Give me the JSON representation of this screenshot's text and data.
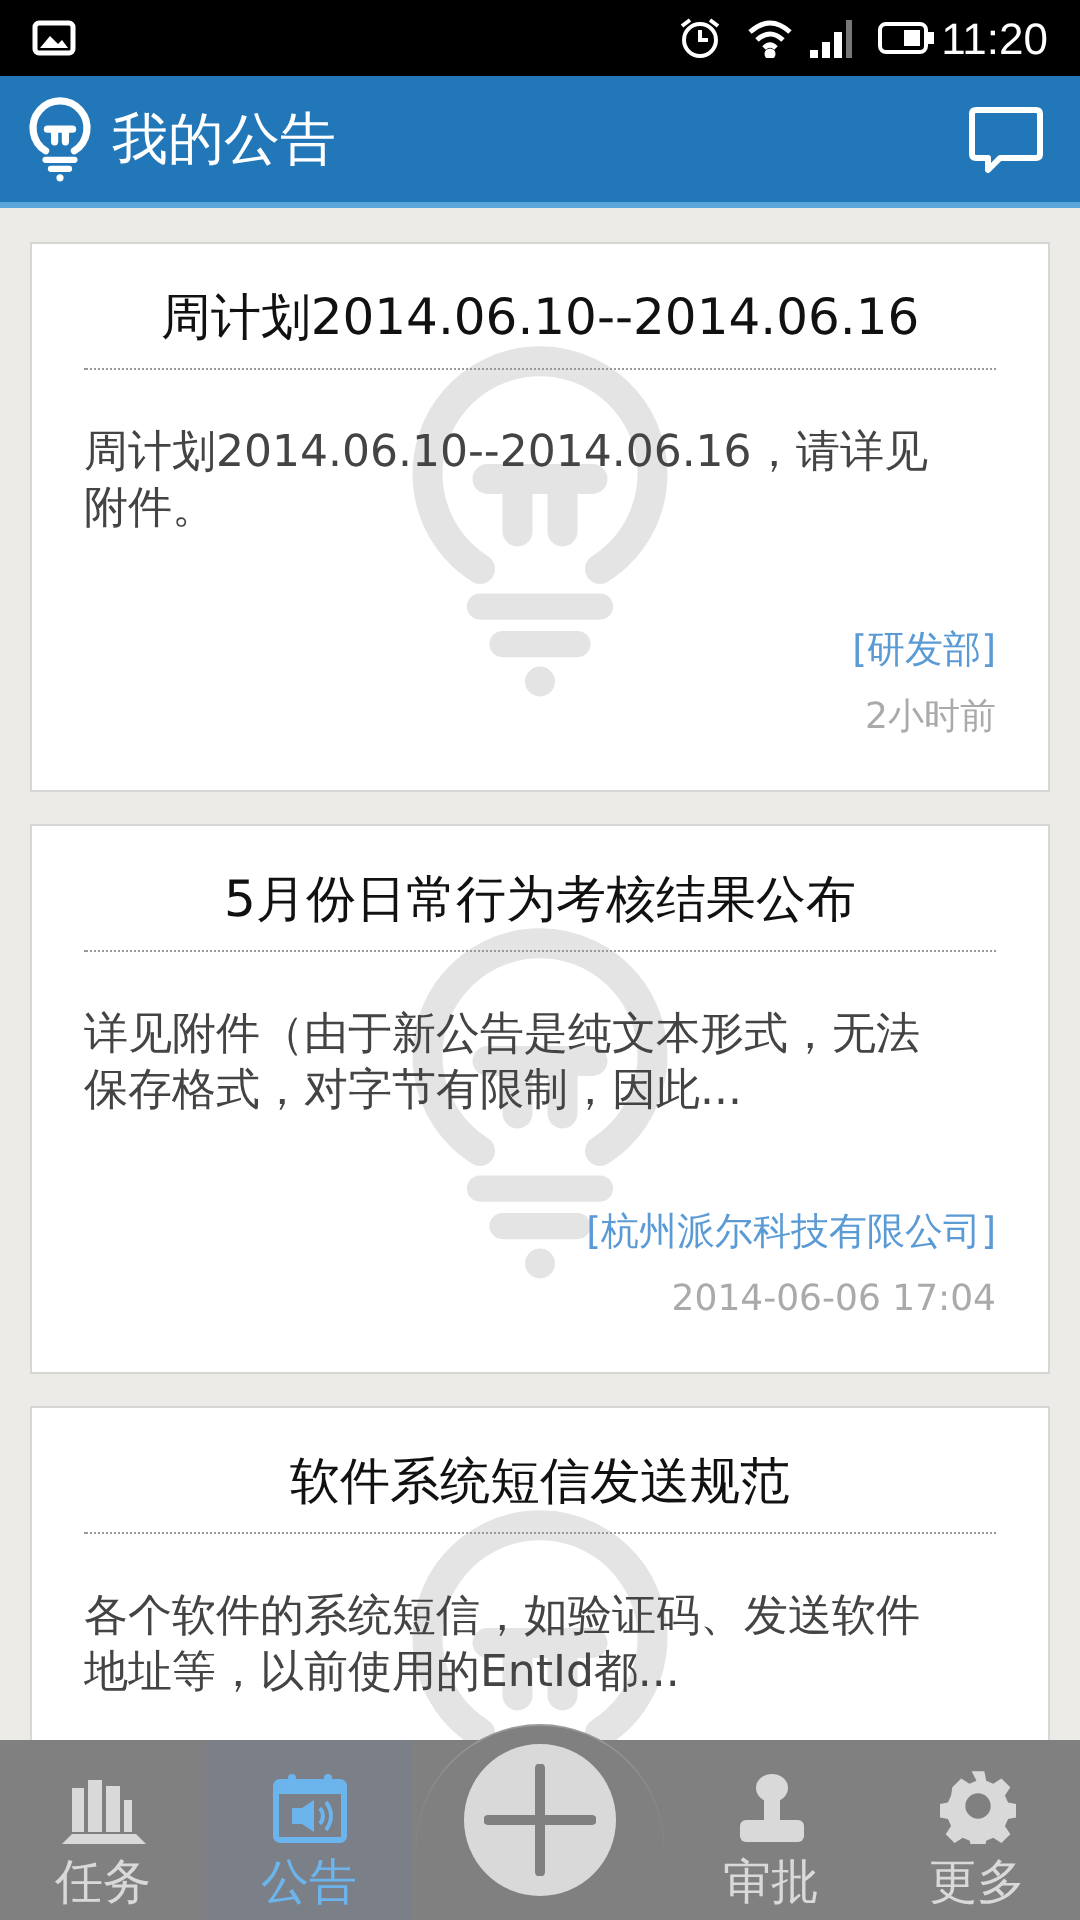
{
  "status_bar": {
    "time": "11:20"
  },
  "header": {
    "title": "我的公告"
  },
  "notices": [
    {
      "title": "周计划2014.06.10--2014.06.16",
      "body": "周计划2014.06.10--2014.06.16，请详见附件。",
      "department": "[研发部]",
      "time": "2小时前"
    },
    {
      "title": "5月份日常行为考核结果公布",
      "body": "详见附件（由于新公告是纯文本形式，无法保存格式，对字节有限制，因此...",
      "department": "[杭州派尔科技有限公司]",
      "time": "2014-06-06 17:04"
    },
    {
      "title": "软件系统短信发送规范",
      "body": "各个软件的系统短信，如验证码、发送软件地址等，以前使用的EntId都..."
    }
  ],
  "tabs": [
    {
      "kind": "tab",
      "label": "任务",
      "selected": false
    },
    {
      "kind": "tab",
      "label": "公告",
      "selected": true
    },
    {
      "kind": "add"
    },
    {
      "kind": "tab",
      "label": "审批",
      "selected": false
    },
    {
      "kind": "tab",
      "label": "更多",
      "selected": false
    }
  ]
}
